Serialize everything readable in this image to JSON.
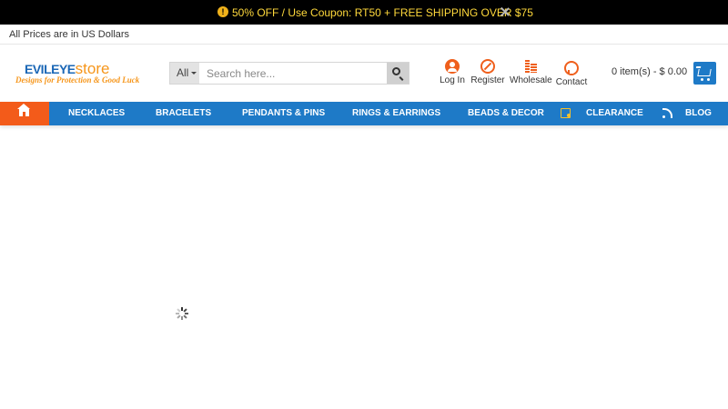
{
  "promo": {
    "text": "50% OFF / Use Coupon: RT50 + FREE SHIPPING OVER  $75",
    "warning_icon": "warning-icon",
    "warning_glyph": "!",
    "close_icon": "close-icon",
    "colors": {
      "background": "#000000",
      "text": "#ffd93b",
      "icon": "#f0b21b"
    }
  },
  "currency_note": "All Prices are in US Dollars",
  "logo": {
    "primary": "EVILEYE",
    "secondary": "store",
    "tagline": "Designs for Protection & Good Luck"
  },
  "search": {
    "category": "All",
    "placeholder": "Search here...",
    "button_icon": "search-icon"
  },
  "header_links": [
    {
      "label": "Log In",
      "icon": "user-icon"
    },
    {
      "label": "Register",
      "icon": "compass-icon"
    },
    {
      "label": "Wholesale",
      "icon": "coins-icon"
    },
    {
      "label": "Contact",
      "icon": "chat-icon"
    }
  ],
  "cart": {
    "summary": "0 item(s) - $ 0.00",
    "icon": "cart-icon"
  },
  "nav": {
    "home_icon": "home-icon",
    "items": [
      "NECKLACES",
      "BRACELETS",
      "PENDANTS & PINS",
      "RINGS & EARRINGS",
      "BEADS & DECOR",
      "CLEARANCE",
      "BLOG"
    ],
    "clearance_icon": "tag-icon",
    "blog_icon": "rss-icon",
    "colors": {
      "bar": "#1e7ac7",
      "home": "#f35b1a",
      "text": "#ffffff"
    }
  },
  "content": {
    "loading_icon": "loading-spinner-icon"
  },
  "colors": {
    "accent_orange": "#ef5f1c",
    "brand_blue": "#1b67b6",
    "brand_orange": "#f6961b"
  }
}
